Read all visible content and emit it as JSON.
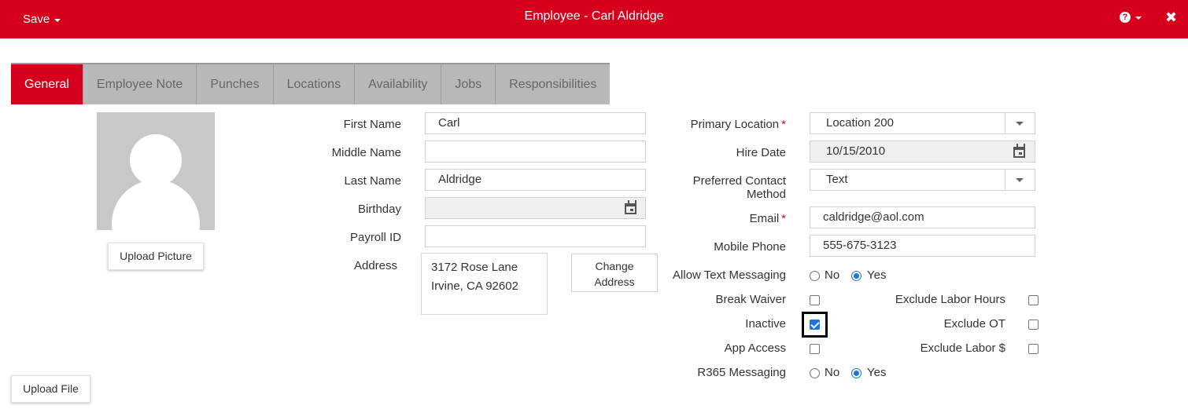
{
  "header": {
    "save_label": "Save",
    "title": "Employee - Carl Aldridge",
    "help_glyph": "?",
    "close_glyph": "✖",
    "brand_color": "#d6001c"
  },
  "tabs": [
    {
      "label": "General",
      "active": true
    },
    {
      "label": "Employee Note"
    },
    {
      "label": "Punches"
    },
    {
      "label": "Locations"
    },
    {
      "label": "Availability"
    },
    {
      "label": "Jobs"
    },
    {
      "label": "Responsibilities"
    }
  ],
  "left": {
    "upload_picture_label": "Upload Picture",
    "upload_file_label": "Upload File"
  },
  "form": {
    "first_name": {
      "label": "First Name",
      "value": "Carl"
    },
    "middle_name": {
      "label": "Middle Name",
      "value": ""
    },
    "last_name": {
      "label": "Last Name",
      "value": "Aldridge"
    },
    "birthday": {
      "label": "Birthday",
      "value": ""
    },
    "payroll_id": {
      "label": "Payroll ID",
      "value": ""
    },
    "address": {
      "label": "Address",
      "line1": "3172 Rose Lane",
      "line2": "Irvine, CA 92602"
    },
    "change_address_line1": "Change",
    "change_address_line2": "Address",
    "primary_location": {
      "label": "Primary Location",
      "value": "Location 200",
      "required_mark": "*"
    },
    "hire_date": {
      "label": "Hire Date",
      "value": "10/15/2010"
    },
    "preferred_contact": {
      "label_line1": "Preferred Contact",
      "label_line2": "Method",
      "value": "Text"
    },
    "email": {
      "label": "Email",
      "value": "caldridge@aol.com",
      "required_mark": "*"
    },
    "mobile_phone": {
      "label": "Mobile Phone",
      "value": "555-675-3123"
    },
    "allow_text_messaging": {
      "label": "Allow Text Messaging",
      "no": "No",
      "yes": "Yes",
      "selected": "Yes"
    },
    "break_waiver": {
      "label": "Break Waiver",
      "checked": false
    },
    "inactive": {
      "label": "Inactive",
      "checked": true
    },
    "app_access": {
      "label": "App Access",
      "checked": false
    },
    "r365_messaging": {
      "label": "R365 Messaging",
      "no": "No",
      "yes": "Yes",
      "selected": "Yes"
    },
    "exclude_labor_hours": {
      "label": "Exclude Labor Hours",
      "checked": false
    },
    "exclude_ot": {
      "label": "Exclude OT",
      "checked": false
    },
    "exclude_labor_dollars": {
      "label": "Exclude Labor $",
      "checked": false
    }
  }
}
